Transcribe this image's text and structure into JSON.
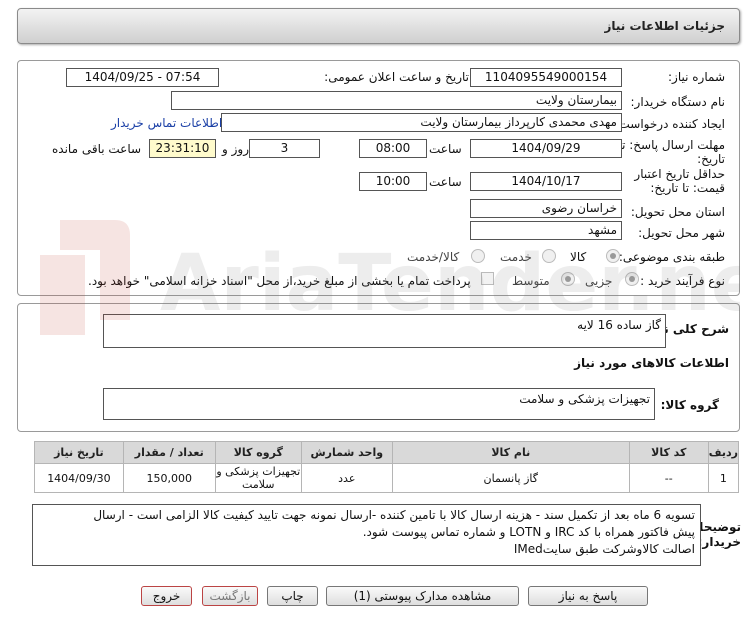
{
  "title": "جزئیات اطلاعات نیاز",
  "form": {
    "need_number_label": "شماره نیاز:",
    "need_number": "1104095549000154",
    "announce_label": "تاریخ و ساعت اعلان عمومی:",
    "announce_value": "1404/09/25 - 07:54",
    "buyer_org_label": "نام دستگاه خریدار:",
    "buyer_org": "بیمارستان ولایت",
    "requester_label": "ایجاد کننده درخواست:",
    "requester": "مهدی محمدی کارپرداز بیمارستان ولایت",
    "contact_link": "اطلاعات تماس خریدار",
    "deadline_label_1": "مهلت ارسال پاسخ: تا",
    "deadline_label_2": "تاریخ:",
    "deadline_date": "1404/09/29",
    "time_label": "ساعت",
    "deadline_time": "08:00",
    "days_value": "3",
    "days_label": "روز و",
    "remaining_time": "23:31:10",
    "remaining_label": "ساعت باقی مانده",
    "validity_label_1": "حداقل تاریخ اعتبار",
    "validity_label_2": "قیمت: تا تاریخ:",
    "validity_date": "1404/10/17",
    "validity_time": "10:00",
    "province_label": "استان محل تحویل:",
    "province": "خراسان رضوی",
    "city_label": "شهر محل تحویل:",
    "city": "مشهد",
    "category_label": "طبقه بندی موضوعی:",
    "category_options": [
      "کالا",
      "خدمت",
      "کالا/خدمت"
    ],
    "category_selected": "کالا",
    "process_label": "نوع فرآیند خرید :",
    "process_options": [
      "جزیی",
      "متوسط"
    ],
    "process_selected": "جزیی",
    "payment_note": "پرداخت تمام یا بخشی از مبلغ خرید،از محل \"اسناد خزانه اسلامی\" خواهد بود."
  },
  "summary": {
    "label": "شرح کلی نیاز:",
    "value": "گاز ساده 16 لایه"
  },
  "goods_info_heading": "اطلاعات کالاهای مورد نیاز",
  "goods_group": {
    "label": "گروه کالا:",
    "value": "تجهیزات پزشکی و سلامت"
  },
  "table": {
    "headers": [
      "ردیف",
      "کد کالا",
      "نام کالا",
      "واحد شمارش",
      "گروه کالا",
      "تعداد / مقدار",
      "تاریخ نیاز"
    ],
    "rows": [
      {
        "row": "1",
        "code": "--",
        "name": "گاز پانسمان",
        "unit": "عدد",
        "group": "تجهیزات پزشکی و سلامت",
        "qty": "150,000",
        "date": "1404/09/30"
      }
    ]
  },
  "buyer_notes": {
    "label_1": "توضیحات",
    "label_2": "خریدار:",
    "line_1": "تسویه 6 ماه بعد از تکمیل سند - هزینه ارسال کالا با تامین کننده -ارسال نمونه جهت تایید کیفیت کالا الزامی است - ارسال",
    "line_2": "پیش فاکتور همراه با کد IRC و LOTN و شماره تماس پیوست شود.",
    "line_3": "اصالت کالاوشرکت طبق سایتIMed"
  },
  "buttons": {
    "reply": "پاسخ به نیاز",
    "attachments": "مشاهده مدارک پیوستی (1)",
    "print": "چاپ",
    "back": "بازگشت",
    "exit": "خروج"
  },
  "watermark": "AriaTender.net"
}
